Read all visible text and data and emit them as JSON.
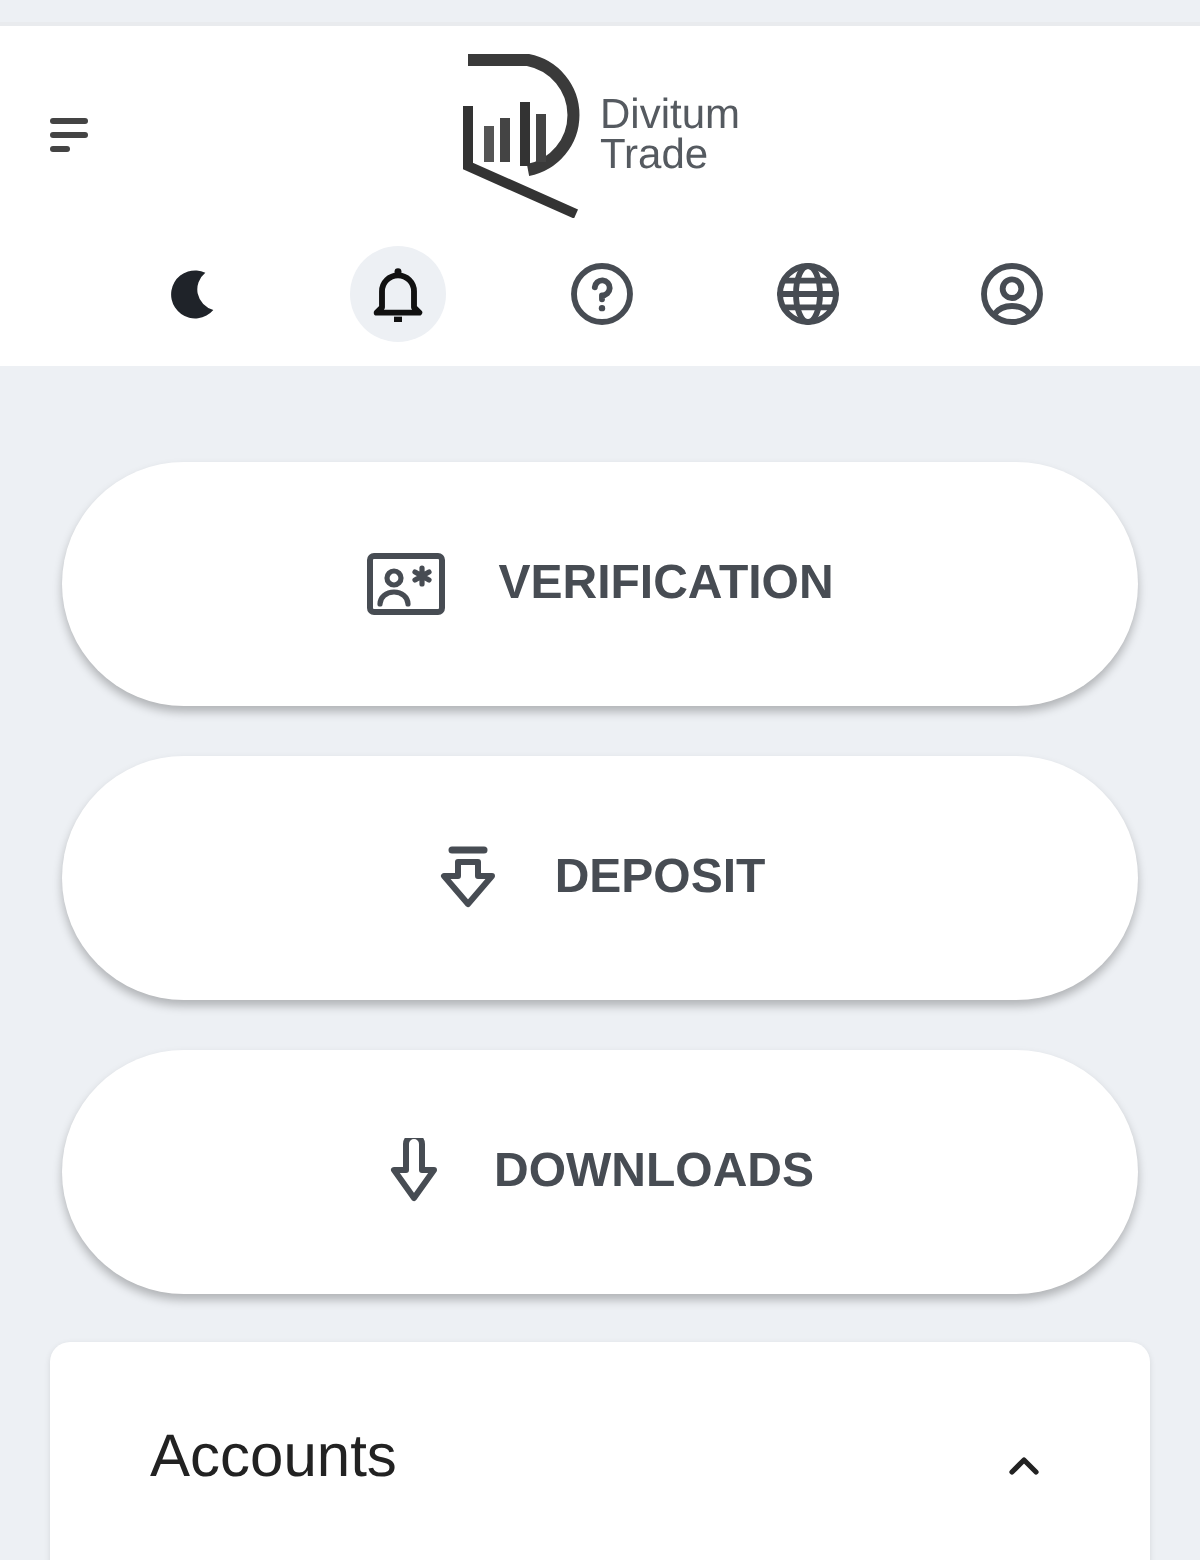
{
  "header": {
    "brand": [
      "Divitum",
      "Trade"
    ],
    "toolbar": [
      {
        "kind": "theme",
        "selected": false
      },
      {
        "kind": "notifications",
        "selected": true
      },
      {
        "kind": "help",
        "selected": false
      },
      {
        "kind": "language",
        "selected": false
      },
      {
        "kind": "profile",
        "selected": false
      }
    ]
  },
  "actions": [
    {
      "kind": "verification",
      "label": "VERIFICATION"
    },
    {
      "kind": "deposit",
      "label": "DEPOSIT"
    },
    {
      "kind": "downloads",
      "label": "DOWNLOADS"
    }
  ],
  "accounts": {
    "title": "Accounts",
    "expanded": true
  }
}
